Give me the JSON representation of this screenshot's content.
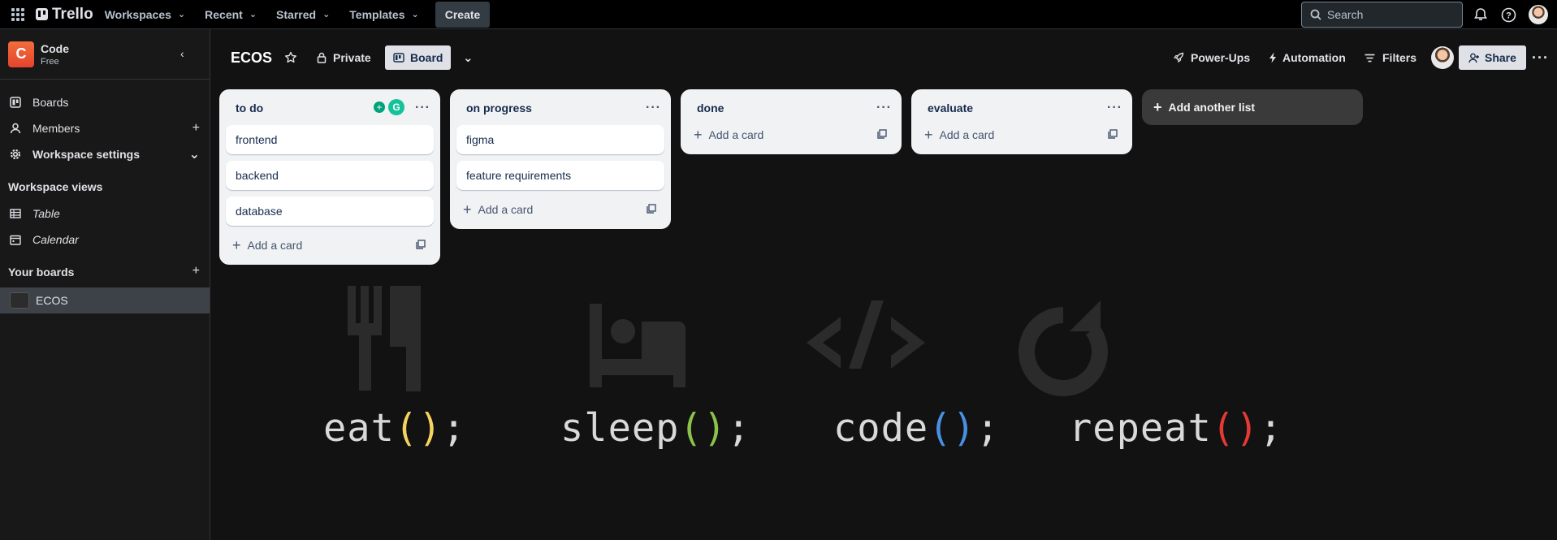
{
  "topbar": {
    "apps_icon": "apps-grid-icon",
    "logo": "Trello",
    "nav": [
      "Workspaces",
      "Recent",
      "Starred",
      "Templates"
    ],
    "create": "Create",
    "search_placeholder": "Search"
  },
  "sidebar": {
    "workspace": {
      "initial": "C",
      "name": "Code",
      "plan": "Free"
    },
    "items": [
      {
        "label": "Boards",
        "icon": "boards-icon"
      },
      {
        "label": "Members",
        "icon": "person-icon"
      },
      {
        "label": "Workspace settings",
        "icon": "gear-icon"
      }
    ],
    "views_heading": "Workspace views",
    "views": [
      {
        "label": "Table",
        "icon": "table-icon"
      },
      {
        "label": "Calendar",
        "icon": "calendar-icon"
      }
    ],
    "boards_heading": "Your boards",
    "boards": [
      {
        "label": "ECOS"
      }
    ]
  },
  "board": {
    "title": "ECOS",
    "visibility": "Private",
    "view": "Board",
    "actions": {
      "powerups": "Power-Ups",
      "automation": "Automation",
      "filters": "Filters",
      "share": "Share"
    }
  },
  "lists": [
    {
      "title": "to do",
      "cards": [
        "frontend",
        "backend",
        "database"
      ],
      "add": "Add a card"
    },
    {
      "title": "on progress",
      "cards": [
        "figma",
        "feature requirements"
      ],
      "add": "Add a card"
    },
    {
      "title": "done",
      "cards": [],
      "add": "Add a card"
    },
    {
      "title": "evaluate",
      "cards": [],
      "add": "Add a card"
    }
  ],
  "add_list": "Add another list",
  "wallpaper": {
    "words": [
      "eat",
      "sleep",
      "code",
      "repeat"
    ],
    "paren_colors": [
      "#f4d35e",
      "#8bc34a",
      "#4a90e2",
      "#e53935"
    ],
    "open_paren": "(",
    "close_paren": ")",
    "suffix": ";"
  }
}
